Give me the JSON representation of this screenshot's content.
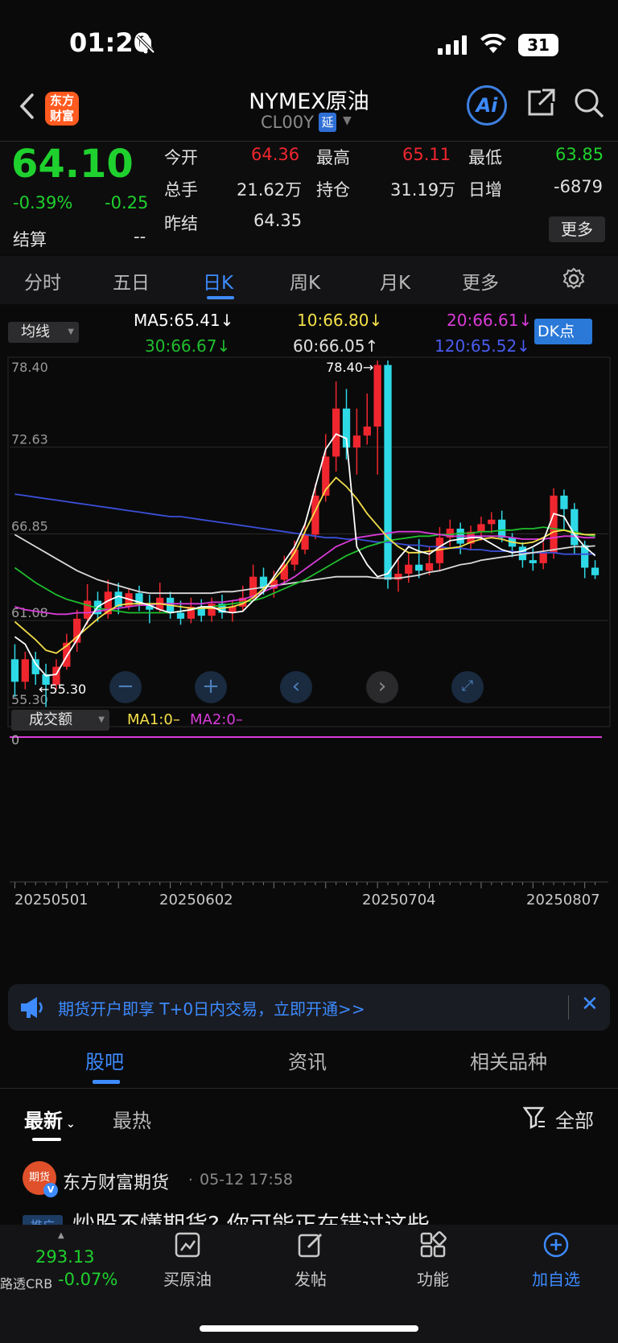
{
  "status_bar": {
    "time": "01:20",
    "battery": "31"
  },
  "nav": {
    "logo_text": "东方财富",
    "title": "NYMEX原油",
    "code": "CL00Y",
    "code_badge": "延",
    "ai_label": "Ai"
  },
  "quote": {
    "price": "64.10",
    "change_pct": "-0.39%",
    "change": "-0.25",
    "settle_label": "结算",
    "settle_value": "--",
    "open_label": "今开",
    "open_value": "64.36",
    "high_label": "最高",
    "high_value": "65.11",
    "low_label": "最低",
    "low_value": "63.85",
    "volume_label": "总手",
    "volume_value": "21.62万",
    "oi_label": "持仓",
    "oi_value": "31.19万",
    "daily_inc_label": "日增",
    "daily_inc_value": "-6879",
    "prev_settle_label": "昨结",
    "prev_settle_value": "64.35",
    "more_button": "更多"
  },
  "tabs": [
    "分时",
    "五日",
    "日K",
    "周K",
    "月K",
    "更多"
  ],
  "active_tab": "日K",
  "indicator": {
    "selector": "均线",
    "ma5": "MA5:65.41↓",
    "ma10": "10:66.80↓",
    "ma20": "20:66.61↓",
    "ma30": "30:66.67↓",
    "ma60": "60:66.05↑",
    "ma120": "120:65.52↓",
    "dk_button": "DK点"
  },
  "chart_data": {
    "type": "candlestick",
    "y_ticks": [
      "78.40",
      "72.63",
      "66.85",
      "61.08",
      "55.30"
    ],
    "ylim": [
      55.3,
      78.4
    ],
    "max_label": "78.40",
    "min_label": "55.30",
    "x_ticks": [
      "20250501",
      "20250602",
      "20250704",
      "20250807"
    ],
    "series_colors": {
      "MA5": "#ffffff",
      "MA10": "#f5e04a",
      "MA20": "#d93bd9",
      "MA30": "#1fbf2e",
      "MA60": "#d8d8d8",
      "MA120": "#3b4fd8"
    },
    "ma5": [
      60.0,
      59.5,
      58.2,
      57.4,
      57.5,
      58.7,
      59.8,
      61.0,
      62.0,
      62.4,
      62.7,
      62.5,
      62.3,
      62.1,
      61.8,
      61.6,
      61.7,
      61.8,
      62.0,
      62.0,
      61.7,
      61.6,
      61.7,
      62.4,
      63.0,
      64.0,
      65.0,
      66.0,
      67.5,
      70.0,
      72.5,
      73.5,
      73.2,
      66.0,
      64.8,
      64.0,
      64.2,
      65.2,
      66.0,
      65.7,
      65.5,
      66.0,
      66.4,
      66.5,
      66.6,
      66.6,
      66.2,
      65.8,
      65.6,
      65.7,
      66.0,
      66.4,
      68.2,
      68.0,
      66.8,
      66.0,
      65.4
    ],
    "ma10": [
      61.0,
      60.4,
      59.8,
      59.1,
      58.9,
      59.4,
      60.0,
      60.6,
      61.2,
      61.7,
      62.1,
      62.2,
      62.2,
      62.2,
      62.2,
      62.1,
      62.0,
      61.9,
      61.9,
      61.9,
      61.9,
      62.0,
      62.2,
      62.6,
      63.2,
      63.8,
      64.6,
      65.6,
      67.0,
      68.4,
      69.8,
      70.6,
      70.0,
      69.2,
      68.2,
      67.4,
      66.6,
      66.0,
      65.6,
      65.6,
      65.7,
      65.8,
      65.9,
      66.0,
      66.3,
      66.5,
      66.6,
      66.5,
      66.3,
      66.2,
      66.3,
      66.6,
      67.0,
      67.1,
      66.9,
      66.8,
      66.8
    ],
    "ma20": [
      62.0,
      61.8,
      61.7,
      61.6,
      61.5,
      61.5,
      61.6,
      61.6,
      61.7,
      61.8,
      61.9,
      62.0,
      62.1,
      62.1,
      62.2,
      62.2,
      62.2,
      62.2,
      62.2,
      62.3,
      62.3,
      62.4,
      62.5,
      62.7,
      63.0,
      63.3,
      63.6,
      64.0,
      64.5,
      65.0,
      65.5,
      66.0,
      66.3,
      66.6,
      66.7,
      66.8,
      66.9,
      67.0,
      67.0,
      67.0,
      66.9,
      66.8,
      66.7,
      66.7,
      66.7,
      66.7,
      66.7,
      66.7,
      66.6,
      66.5,
      66.5,
      66.5,
      66.6,
      66.7,
      66.7,
      66.6,
      66.6
    ],
    "ma30": [
      64.6,
      64.1,
      63.6,
      63.2,
      62.8,
      62.5,
      62.3,
      62.1,
      61.9,
      61.8,
      61.7,
      61.6,
      61.6,
      61.6,
      61.6,
      61.6,
      61.7,
      61.8,
      61.9,
      62.0,
      62.1,
      62.2,
      62.3,
      62.4,
      62.6,
      62.9,
      63.2,
      63.5,
      63.8,
      64.2,
      64.6,
      65.0,
      65.4,
      65.7,
      66.0,
      66.2,
      66.4,
      66.5,
      66.6,
      66.7,
      66.7,
      66.8,
      66.8,
      66.9,
      66.9,
      67.0,
      67.0,
      67.1,
      67.1,
      67.2,
      67.2,
      67.3,
      67.2,
      67.1,
      67.0,
      66.8,
      66.7
    ],
    "ma60": [
      66.8,
      66.4,
      66.0,
      65.6,
      65.2,
      64.8,
      64.4,
      64.1,
      63.8,
      63.6,
      63.4,
      63.2,
      63.0,
      62.9,
      62.9,
      62.9,
      62.9,
      62.9,
      62.9,
      62.9,
      63.0,
      63.0,
      63.1,
      63.2,
      63.3,
      63.4,
      63.5,
      63.6,
      63.7,
      63.8,
      63.9,
      64.0,
      64.0,
      64.0,
      64.0,
      63.9,
      63.9,
      63.9,
      64.0,
      64.1,
      64.3,
      64.4,
      64.6,
      64.8,
      64.9,
      65.1,
      65.2,
      65.3,
      65.4,
      65.5,
      65.6,
      65.7,
      65.8,
      65.9,
      66.0,
      66.0,
      66.05
    ],
    "ma120": [
      69.5,
      69.4,
      69.3,
      69.2,
      69.1,
      69.0,
      68.9,
      68.8,
      68.7,
      68.6,
      68.5,
      68.4,
      68.3,
      68.2,
      68.1,
      68.0,
      68.0,
      67.9,
      67.8,
      67.7,
      67.6,
      67.5,
      67.4,
      67.3,
      67.2,
      67.1,
      67.0,
      66.9,
      66.8,
      66.7,
      66.6,
      66.6,
      66.5,
      66.5,
      66.4,
      66.3,
      66.3,
      66.2,
      66.1,
      66.1,
      66.0,
      66.0,
      65.9,
      65.9,
      65.8,
      65.8,
      65.7,
      65.7,
      65.7,
      65.6,
      65.6,
      65.6,
      65.6,
      65.5,
      65.5,
      65.5,
      65.52
    ],
    "candles": [
      [
        58.5,
        57.0,
        59.5,
        56.0
      ],
      [
        57.0,
        58.5,
        59.0,
        56.5
      ],
      [
        58.5,
        57.5,
        59.0,
        56.8
      ],
      [
        57.5,
        56.8,
        58.2,
        55.3
      ],
      [
        56.8,
        58.0,
        58.5,
        56.5
      ],
      [
        58.0,
        59.6,
        60.2,
        57.8
      ],
      [
        59.6,
        61.2,
        61.8,
        59.0
      ],
      [
        61.2,
        62.4,
        63.5,
        60.8
      ],
      [
        62.4,
        61.5,
        63.0,
        61.0
      ],
      [
        61.5,
        63.0,
        63.8,
        61.2
      ],
      [
        63.0,
        62.0,
        63.6,
        61.5
      ],
      [
        62.0,
        62.9,
        63.2,
        61.8
      ],
      [
        62.9,
        62.2,
        63.4,
        61.7
      ],
      [
        62.2,
        61.8,
        62.8,
        60.9
      ],
      [
        61.8,
        62.6,
        63.6,
        61.6
      ],
      [
        62.6,
        61.6,
        63.0,
        61.2
      ],
      [
        61.6,
        61.2,
        62.4,
        60.8
      ],
      [
        61.2,
        62.0,
        62.6,
        60.9
      ],
      [
        62.0,
        61.4,
        62.5,
        61.0
      ],
      [
        61.4,
        62.2,
        62.6,
        61.0
      ],
      [
        62.2,
        61.6,
        62.8,
        61.2
      ],
      [
        61.6,
        62.0,
        62.4,
        61.0
      ],
      [
        62.0,
        62.6,
        63.4,
        61.7
      ],
      [
        62.6,
        64.0,
        64.8,
        62.5
      ],
      [
        64.0,
        63.2,
        64.6,
        62.8
      ],
      [
        63.2,
        63.8,
        64.4,
        62.6
      ],
      [
        63.8,
        64.8,
        65.4,
        63.5
      ],
      [
        64.8,
        65.8,
        66.4,
        64.4
      ],
      [
        65.8,
        66.8,
        67.6,
        65.5
      ],
      [
        66.8,
        69.4,
        70.2,
        66.5
      ],
      [
        69.4,
        72.0,
        73.5,
        69.0
      ],
      [
        72.0,
        75.2,
        77.0,
        71.0
      ],
      [
        75.2,
        72.6,
        76.5,
        71.8
      ],
      [
        72.6,
        73.4,
        75.2,
        70.8
      ],
      [
        73.4,
        74.0,
        76.2,
        72.8
      ],
      [
        74.0,
        78.1,
        78.4,
        70.8
      ],
      [
        78.1,
        63.8,
        78.4,
        63.2
      ],
      [
        63.8,
        64.2,
        65.2,
        63.0
      ],
      [
        64.2,
        64.8,
        65.6,
        63.6
      ],
      [
        64.8,
        64.4,
        66.5,
        63.9
      ],
      [
        64.4,
        64.9,
        66.0,
        64.1
      ],
      [
        64.9,
        66.6,
        67.3,
        64.4
      ],
      [
        66.6,
        67.2,
        67.8,
        66.0
      ],
      [
        67.2,
        66.2,
        67.6,
        65.5
      ],
      [
        66.2,
        67.0,
        67.4,
        65.8
      ],
      [
        67.0,
        67.5,
        68.0,
        66.4
      ],
      [
        67.5,
        67.8,
        68.3,
        66.9
      ],
      [
        67.8,
        66.6,
        68.4,
        66.3
      ],
      [
        66.6,
        66.0,
        66.9,
        65.3
      ],
      [
        66.0,
        65.1,
        66.3,
        64.6
      ],
      [
        65.1,
        64.9,
        65.9,
        64.4
      ],
      [
        64.9,
        65.6,
        66.3,
        64.5
      ],
      [
        65.6,
        69.4,
        69.9,
        65.2
      ],
      [
        69.4,
        68.5,
        69.8,
        67.1
      ],
      [
        68.5,
        66.1,
        68.9,
        65.5
      ],
      [
        66.1,
        64.6,
        66.4,
        63.9
      ],
      [
        64.6,
        64.1,
        65.1,
        63.85
      ]
    ]
  },
  "zoom_controls": [
    "minus",
    "plus",
    "left",
    "right",
    "fullscreen"
  ],
  "volume_panel": {
    "selector": "成交额",
    "ma1": "MA1:0–",
    "ma2": "MA2:0–",
    "zero": "0"
  },
  "banner": {
    "text": "期货开户即享 T+0日内交易，立即开通>>"
  },
  "segments": [
    "股吧",
    "资讯",
    "相关品种"
  ],
  "active_segment": "股吧",
  "filters": {
    "latest": "最新",
    "hottest": "最热",
    "all": "全部"
  },
  "post": {
    "author": "东方财富期货",
    "avatar_text": "期货",
    "time": "05-12 17:58",
    "tag": "推广",
    "title_partial": "炒股不懂期货? 你可能正在错过这些"
  },
  "bottom_bar": {
    "index_value": "293.13",
    "index_name": "路透CRB",
    "index_change": "-0.07%",
    "items": [
      "买原油",
      "发帖",
      "功能",
      "加自选"
    ]
  },
  "colors": {
    "up": "#f0262f",
    "down": "#2ed9e6",
    "accent": "#3d8bff",
    "brand_orange": "#ff5a1f"
  }
}
